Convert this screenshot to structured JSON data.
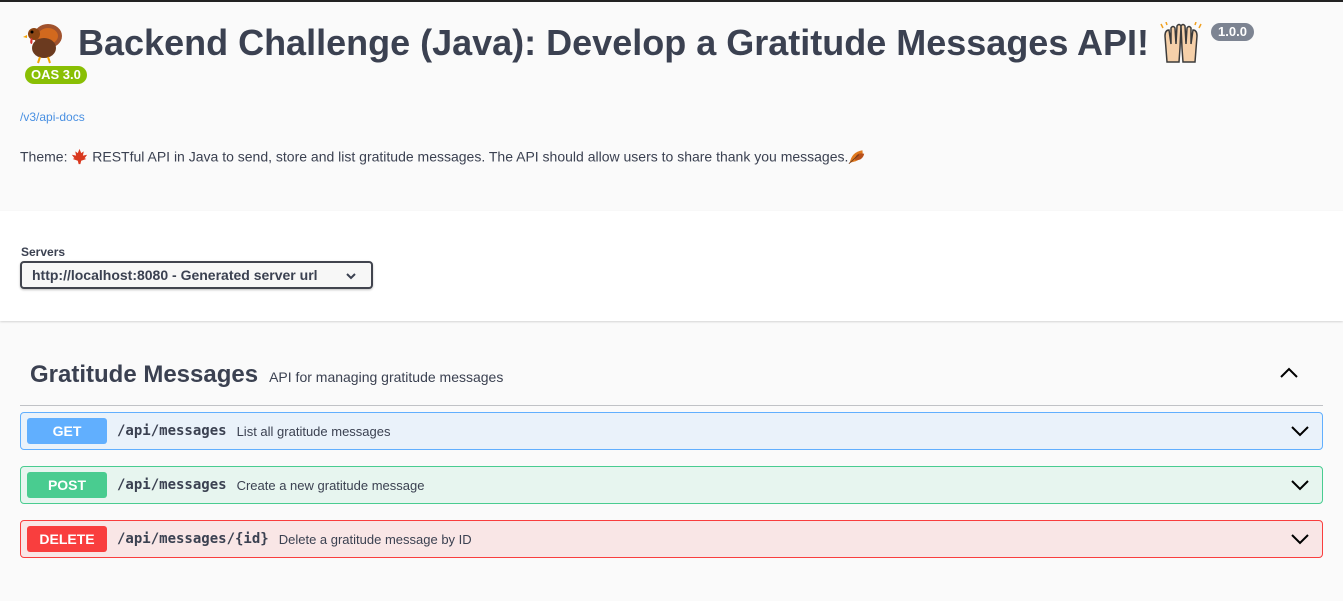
{
  "info": {
    "title": "Backend Challenge (Java): Develop a Gratitude Messages API!",
    "version": "1.0.0",
    "oas_version": "OAS 3.0",
    "api_docs_link": "/v3/api-docs",
    "description_prefix": "Theme:",
    "description": "RESTful API in Java to send, store and list gratitude messages. The API should allow users to share thank you messages.",
    "icons": [
      "turkey-icon",
      "raising-hands-icon",
      "maple-leaf-icon",
      "fallen-leaf-icon"
    ]
  },
  "servers": {
    "label": "Servers",
    "selected": "http://localhost:8080 - Generated server url"
  },
  "tag": {
    "name": "Gratitude Messages",
    "description": "API for managing gratitude messages",
    "expanded": true
  },
  "operations": [
    {
      "method": "GET",
      "path": "/api/messages",
      "summary": "List all gratitude messages",
      "color": "#61affe"
    },
    {
      "method": "POST",
      "path": "/api/messages",
      "summary": "Create a new gratitude message",
      "color": "#49cc90"
    },
    {
      "method": "DELETE",
      "path": "/api/messages/{id}",
      "summary": "Delete a gratitude message by ID",
      "color": "#f93e3e"
    }
  ]
}
